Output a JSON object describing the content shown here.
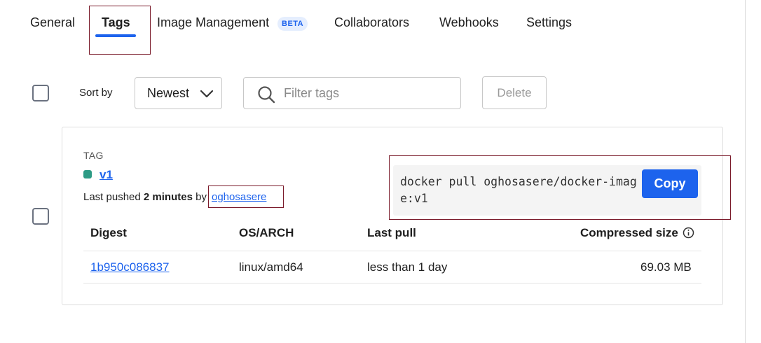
{
  "tabs": [
    {
      "label": "General"
    },
    {
      "label": "Tags"
    },
    {
      "label": "Image Management"
    },
    {
      "label": "Collaborators"
    },
    {
      "label": "Webhooks"
    },
    {
      "label": "Settings"
    }
  ],
  "beta_badge": "BETA",
  "toolbar": {
    "sort_label": "Sort by",
    "sort_value": "Newest",
    "filter_placeholder": "Filter tags",
    "delete_label": "Delete"
  },
  "tag_card": {
    "caption": "TAG",
    "name": "v1",
    "pushed_prefix": "Last pushed ",
    "pushed_time": "2 minutes",
    "pushed_by": " by ",
    "pushed_user": "oghosasere",
    "pull_command": "docker pull oghosasere/docker-image:v1",
    "copy_label": "Copy",
    "table": {
      "headers": [
        "Digest",
        "OS/ARCH",
        "Last pull",
        "Compressed size"
      ],
      "rows": [
        {
          "digest": "1b950c086837",
          "os_arch": "linux/amd64",
          "last_pull": "less than 1 day",
          "size": "69.03 MB"
        }
      ]
    }
  },
  "colors": {
    "accent": "#1d63ed",
    "tag_status": "#2d9b85",
    "highlight_outline": "#7a1a2a"
  },
  "icons": [
    "search-icon",
    "chevron-down-icon",
    "info-icon"
  ]
}
